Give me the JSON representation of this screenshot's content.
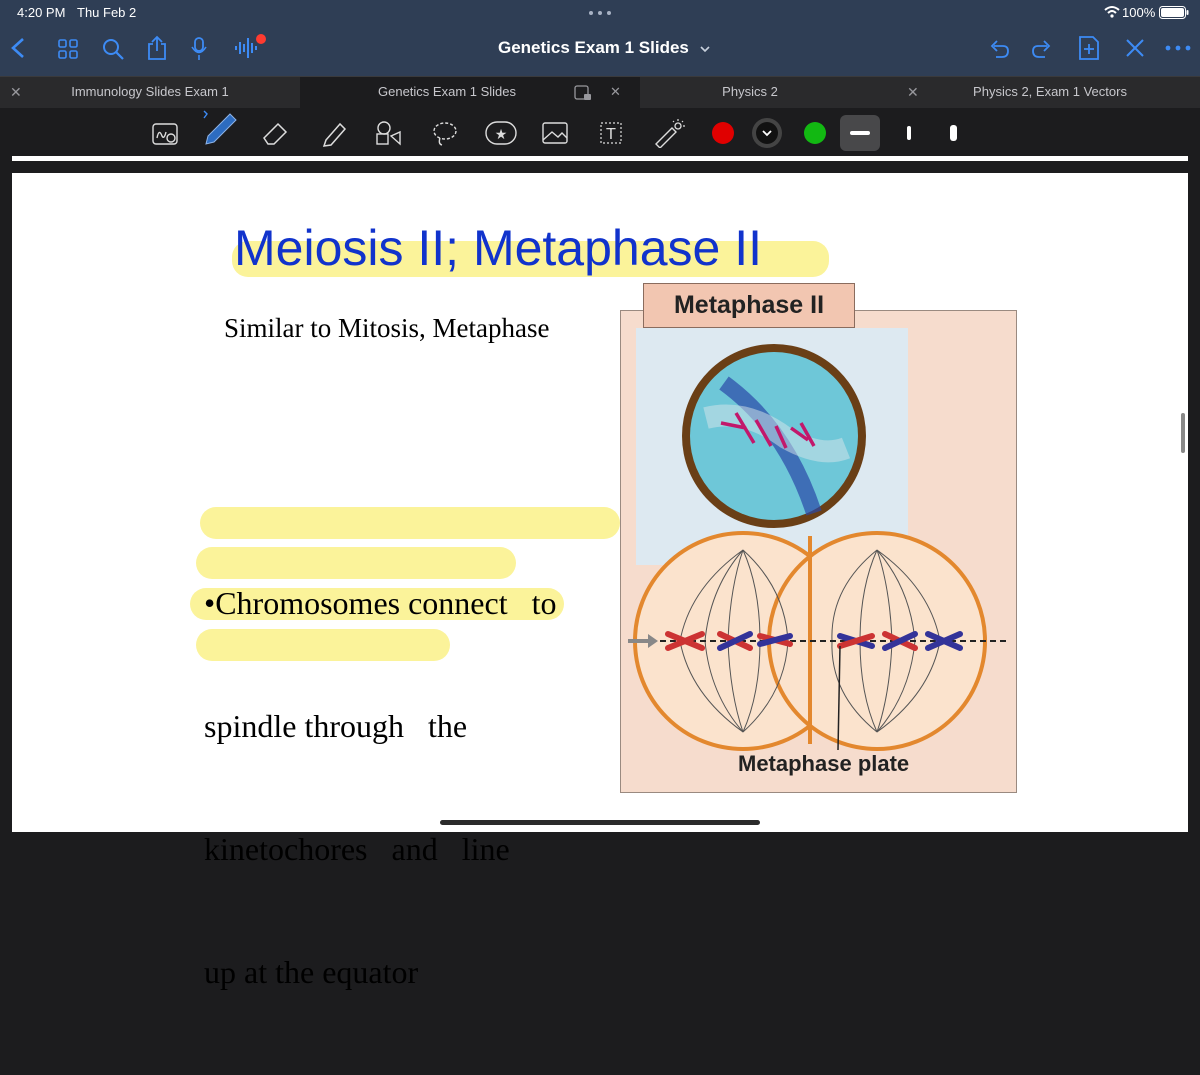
{
  "status_bar": {
    "time": "4:20 PM",
    "date": "Thu Feb 2",
    "battery": "100%"
  },
  "nav": {
    "title": "Genetics Exam 1 Slides",
    "chevron": "chevron-down-icon"
  },
  "tabs": [
    {
      "label": "Immunology Slides Exam 1",
      "active": false
    },
    {
      "label": "Genetics Exam 1 Slides",
      "active": true
    },
    {
      "label": "Physics 2",
      "active": false
    },
    {
      "label": "Physics 2, Exam 1 Vectors",
      "active": false
    }
  ],
  "toolbar": {
    "colors": [
      "#e00000",
      "#111111",
      "#12b812"
    ],
    "selected_color": "#111111"
  },
  "slide": {
    "title": "Meiosis II; Metaphase II",
    "subtitle": "Similar to Mitosis, Metaphase",
    "bullet_lines": [
      "•Chromosomes connect   to",
      "spindle through   the",
      "kinetochores   and   line",
      "up at the equator"
    ],
    "figure_label": "Metaphase II",
    "figure_caption": "Metaphase plate"
  },
  "colors": {
    "title_blue": "#1133cc",
    "highlight": "#fbf39a",
    "figure_bg": "#f6dccd",
    "spindle": "#e3882e"
  }
}
